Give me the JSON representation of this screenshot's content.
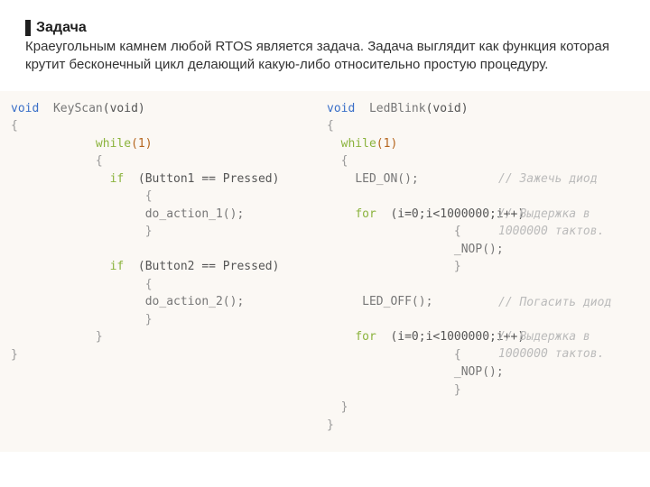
{
  "header": {
    "title": "Задача",
    "description": "Краеугольным камнем любой RTOS является задача. Задача выглядит как функция которая крутит бесконечный цикл делающий какую-либо относительно простую процедуру."
  },
  "code_left": {
    "kw_void": "void",
    "fn_name": "KeyScan",
    "fn_params": "(void)",
    "kw_while": "while",
    "while_arg": "(1)",
    "kw_if": "if",
    "if1_cond": "(Button1 == Pressed)",
    "if1_body": "do_action_1();",
    "if2_cond": "(Button2 == Pressed)",
    "if2_body": "do_action_2();",
    "brace_open": "{",
    "brace_close": "}"
  },
  "code_right": {
    "kw_void": "void",
    "fn_name": "LedBlink",
    "fn_params": "(void)",
    "kw_while": "while",
    "while_arg": "(1)",
    "led_on": "LED_ON();",
    "led_off": "LED_OFF();",
    "kw_for": "for",
    "for_cond": "(i=0;i<1000000;i++)",
    "nop": "_NOP();",
    "brace_open": "{",
    "brace_close": "}",
    "comment_on": "// Зажечь диод",
    "comment_delay": "// Выдержка в 1000000 тактов.",
    "comment_off": "// Погасить диод"
  }
}
